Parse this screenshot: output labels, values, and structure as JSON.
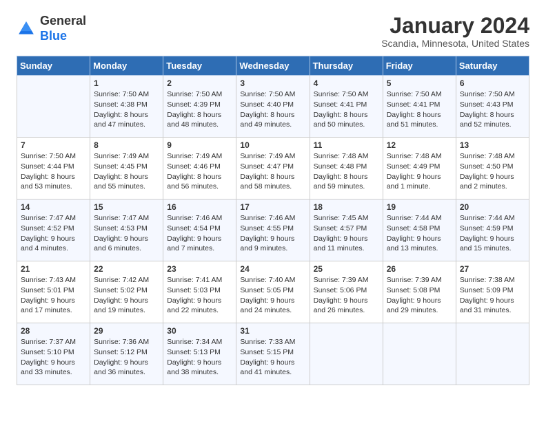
{
  "header": {
    "logo_general": "General",
    "logo_blue": "Blue",
    "month": "January 2024",
    "location": "Scandia, Minnesota, United States"
  },
  "days_of_week": [
    "Sunday",
    "Monday",
    "Tuesday",
    "Wednesday",
    "Thursday",
    "Friday",
    "Saturday"
  ],
  "weeks": [
    [
      {
        "day": "",
        "sunrise": "",
        "sunset": "",
        "daylight": ""
      },
      {
        "day": "1",
        "sunrise": "Sunrise: 7:50 AM",
        "sunset": "Sunset: 4:38 PM",
        "daylight": "Daylight: 8 hours and 47 minutes."
      },
      {
        "day": "2",
        "sunrise": "Sunrise: 7:50 AM",
        "sunset": "Sunset: 4:39 PM",
        "daylight": "Daylight: 8 hours and 48 minutes."
      },
      {
        "day": "3",
        "sunrise": "Sunrise: 7:50 AM",
        "sunset": "Sunset: 4:40 PM",
        "daylight": "Daylight: 8 hours and 49 minutes."
      },
      {
        "day": "4",
        "sunrise": "Sunrise: 7:50 AM",
        "sunset": "Sunset: 4:41 PM",
        "daylight": "Daylight: 8 hours and 50 minutes."
      },
      {
        "day": "5",
        "sunrise": "Sunrise: 7:50 AM",
        "sunset": "Sunset: 4:41 PM",
        "daylight": "Daylight: 8 hours and 51 minutes."
      },
      {
        "day": "6",
        "sunrise": "Sunrise: 7:50 AM",
        "sunset": "Sunset: 4:43 PM",
        "daylight": "Daylight: 8 hours and 52 minutes."
      }
    ],
    [
      {
        "day": "7",
        "sunrise": "Sunrise: 7:50 AM",
        "sunset": "Sunset: 4:44 PM",
        "daylight": "Daylight: 8 hours and 53 minutes."
      },
      {
        "day": "8",
        "sunrise": "Sunrise: 7:49 AM",
        "sunset": "Sunset: 4:45 PM",
        "daylight": "Daylight: 8 hours and 55 minutes."
      },
      {
        "day": "9",
        "sunrise": "Sunrise: 7:49 AM",
        "sunset": "Sunset: 4:46 PM",
        "daylight": "Daylight: 8 hours and 56 minutes."
      },
      {
        "day": "10",
        "sunrise": "Sunrise: 7:49 AM",
        "sunset": "Sunset: 4:47 PM",
        "daylight": "Daylight: 8 hours and 58 minutes."
      },
      {
        "day": "11",
        "sunrise": "Sunrise: 7:48 AM",
        "sunset": "Sunset: 4:48 PM",
        "daylight": "Daylight: 8 hours and 59 minutes."
      },
      {
        "day": "12",
        "sunrise": "Sunrise: 7:48 AM",
        "sunset": "Sunset: 4:49 PM",
        "daylight": "Daylight: 9 hours and 1 minute."
      },
      {
        "day": "13",
        "sunrise": "Sunrise: 7:48 AM",
        "sunset": "Sunset: 4:50 PM",
        "daylight": "Daylight: 9 hours and 2 minutes."
      }
    ],
    [
      {
        "day": "14",
        "sunrise": "Sunrise: 7:47 AM",
        "sunset": "Sunset: 4:52 PM",
        "daylight": "Daylight: 9 hours and 4 minutes."
      },
      {
        "day": "15",
        "sunrise": "Sunrise: 7:47 AM",
        "sunset": "Sunset: 4:53 PM",
        "daylight": "Daylight: 9 hours and 6 minutes."
      },
      {
        "day": "16",
        "sunrise": "Sunrise: 7:46 AM",
        "sunset": "Sunset: 4:54 PM",
        "daylight": "Daylight: 9 hours and 7 minutes."
      },
      {
        "day": "17",
        "sunrise": "Sunrise: 7:46 AM",
        "sunset": "Sunset: 4:55 PM",
        "daylight": "Daylight: 9 hours and 9 minutes."
      },
      {
        "day": "18",
        "sunrise": "Sunrise: 7:45 AM",
        "sunset": "Sunset: 4:57 PM",
        "daylight": "Daylight: 9 hours and 11 minutes."
      },
      {
        "day": "19",
        "sunrise": "Sunrise: 7:44 AM",
        "sunset": "Sunset: 4:58 PM",
        "daylight": "Daylight: 9 hours and 13 minutes."
      },
      {
        "day": "20",
        "sunrise": "Sunrise: 7:44 AM",
        "sunset": "Sunset: 4:59 PM",
        "daylight": "Daylight: 9 hours and 15 minutes."
      }
    ],
    [
      {
        "day": "21",
        "sunrise": "Sunrise: 7:43 AM",
        "sunset": "Sunset: 5:01 PM",
        "daylight": "Daylight: 9 hours and 17 minutes."
      },
      {
        "day": "22",
        "sunrise": "Sunrise: 7:42 AM",
        "sunset": "Sunset: 5:02 PM",
        "daylight": "Daylight: 9 hours and 19 minutes."
      },
      {
        "day": "23",
        "sunrise": "Sunrise: 7:41 AM",
        "sunset": "Sunset: 5:03 PM",
        "daylight": "Daylight: 9 hours and 22 minutes."
      },
      {
        "day": "24",
        "sunrise": "Sunrise: 7:40 AM",
        "sunset": "Sunset: 5:05 PM",
        "daylight": "Daylight: 9 hours and 24 minutes."
      },
      {
        "day": "25",
        "sunrise": "Sunrise: 7:39 AM",
        "sunset": "Sunset: 5:06 PM",
        "daylight": "Daylight: 9 hours and 26 minutes."
      },
      {
        "day": "26",
        "sunrise": "Sunrise: 7:39 AM",
        "sunset": "Sunset: 5:08 PM",
        "daylight": "Daylight: 9 hours and 29 minutes."
      },
      {
        "day": "27",
        "sunrise": "Sunrise: 7:38 AM",
        "sunset": "Sunset: 5:09 PM",
        "daylight": "Daylight: 9 hours and 31 minutes."
      }
    ],
    [
      {
        "day": "28",
        "sunrise": "Sunrise: 7:37 AM",
        "sunset": "Sunset: 5:10 PM",
        "daylight": "Daylight: 9 hours and 33 minutes."
      },
      {
        "day": "29",
        "sunrise": "Sunrise: 7:36 AM",
        "sunset": "Sunset: 5:12 PM",
        "daylight": "Daylight: 9 hours and 36 minutes."
      },
      {
        "day": "30",
        "sunrise": "Sunrise: 7:34 AM",
        "sunset": "Sunset: 5:13 PM",
        "daylight": "Daylight: 9 hours and 38 minutes."
      },
      {
        "day": "31",
        "sunrise": "Sunrise: 7:33 AM",
        "sunset": "Sunset: 5:15 PM",
        "daylight": "Daylight: 9 hours and 41 minutes."
      },
      {
        "day": "",
        "sunrise": "",
        "sunset": "",
        "daylight": ""
      },
      {
        "day": "",
        "sunrise": "",
        "sunset": "",
        "daylight": ""
      },
      {
        "day": "",
        "sunrise": "",
        "sunset": "",
        "daylight": ""
      }
    ]
  ],
  "colors": {
    "header_bg": "#2e6db4",
    "header_text": "#ffffff",
    "odd_row": "#f5f8ff",
    "even_row": "#ffffff"
  }
}
